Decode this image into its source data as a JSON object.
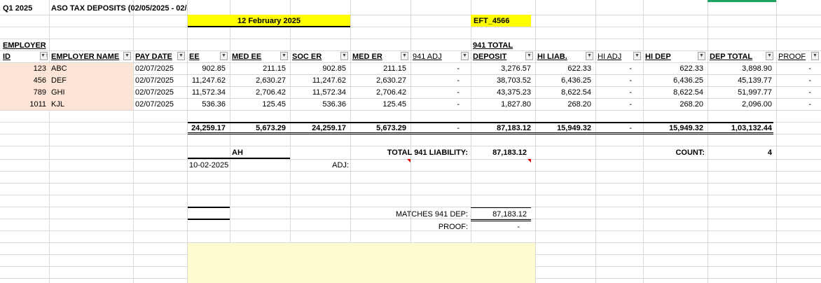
{
  "top": {
    "quarter": "Q1 2025",
    "title": "ASO TAX DEPOSITS (02/05/2025 - 02/0"
  },
  "header_band": {
    "date": "12 February 2025",
    "eft": "EFT_4566"
  },
  "columns": {
    "employer_id_line1": "EMPLOYER",
    "employer_id_line2": "ID",
    "employer_name": "EMPLOYER NAME",
    "pay_date": "PAY DATE",
    "ee": "EE",
    "med_ee": "MED EE",
    "soc_er": "SOC ER",
    "med_er": "MED ER",
    "adj941": "941 ADJ",
    "total941_line1": "941 TOTAL",
    "total941_line2": "DEPOSIT",
    "hi_liab": "HI LIAB.",
    "hi_adj": "HI ADJ",
    "hi_dep": "HI DEP",
    "dep_total": "DEP TOTAL",
    "proof": "PROOF"
  },
  "rows": [
    {
      "id": "123",
      "name": "ABC",
      "pay_date": "02/07/2025",
      "ee": "902.85",
      "med_ee": "211.15",
      "soc_er": "902.85",
      "med_er": "211.15",
      "adj941": "-",
      "total941": "3,276.57",
      "hi_liab": "622.33",
      "hi_adj": "-",
      "hi_dep": "622.33",
      "dep_total": "3,898.90",
      "proof": "-"
    },
    {
      "id": "456",
      "name": "DEF",
      "pay_date": "02/07/2025",
      "ee": "11,247.62",
      "med_ee": "2,630.27",
      "soc_er": "11,247.62",
      "med_er": "2,630.27",
      "adj941": "-",
      "total941": "38,703.52",
      "hi_liab": "6,436.25",
      "hi_adj": "-",
      "hi_dep": "6,436.25",
      "dep_total": "45,139.77",
      "proof": "-"
    },
    {
      "id": "789",
      "name": "GHI",
      "pay_date": "02/07/2025",
      "ee": "11,572.34",
      "med_ee": "2,706.42",
      "soc_er": "11,572.34",
      "med_er": "2,706.42",
      "adj941": "-",
      "total941": "43,375.23",
      "hi_liab": "8,622.54",
      "hi_adj": "-",
      "hi_dep": "8,622.54",
      "dep_total": "51,997.77",
      "proof": "-"
    },
    {
      "id": "1011",
      "name": "KJL",
      "pay_date": "02/07/2025",
      "ee": "536.36",
      "med_ee": "125.45",
      "soc_er": "536.36",
      "med_er": "125.45",
      "adj941": "-",
      "total941": "1,827.80",
      "hi_liab": "268.20",
      "hi_adj": "-",
      "hi_dep": "268.20",
      "dep_total": "2,096.00",
      "proof": "-"
    }
  ],
  "totals": {
    "ee": "24,259.17",
    "med_ee": "5,673.29",
    "soc_er": "24,259.17",
    "med_er": "5,673.29",
    "adj941": "-",
    "total941": "87,183.12",
    "hi_liab": "15,949.32",
    "hi_adj": "-",
    "hi_dep": "15,949.32",
    "dep_total": "1,03,132.44"
  },
  "summary": {
    "ah_label": "AH",
    "ah_date": "10-02-2025",
    "total_liability_label": "TOTAL 941 LIABILITY:",
    "total_liability_value": "87,183.12",
    "adj_label": "ADJ:",
    "count_label": "COUNT:",
    "count_value": "4",
    "matches_label": "MATCHES 941 DEP:",
    "matches_value": "87,183.12",
    "proof_label": "PROOF:",
    "proof_value": "-"
  },
  "colors": {
    "yellow": "#ffff00",
    "peach": "#fce4d6",
    "light_yellow": "#fffdd0",
    "excel_green": "#21a366"
  },
  "icons": {
    "filter": "dropdown-arrow-icon",
    "sort_filter": "sort-filter-icon",
    "comment": "comment-indicator-icon"
  }
}
